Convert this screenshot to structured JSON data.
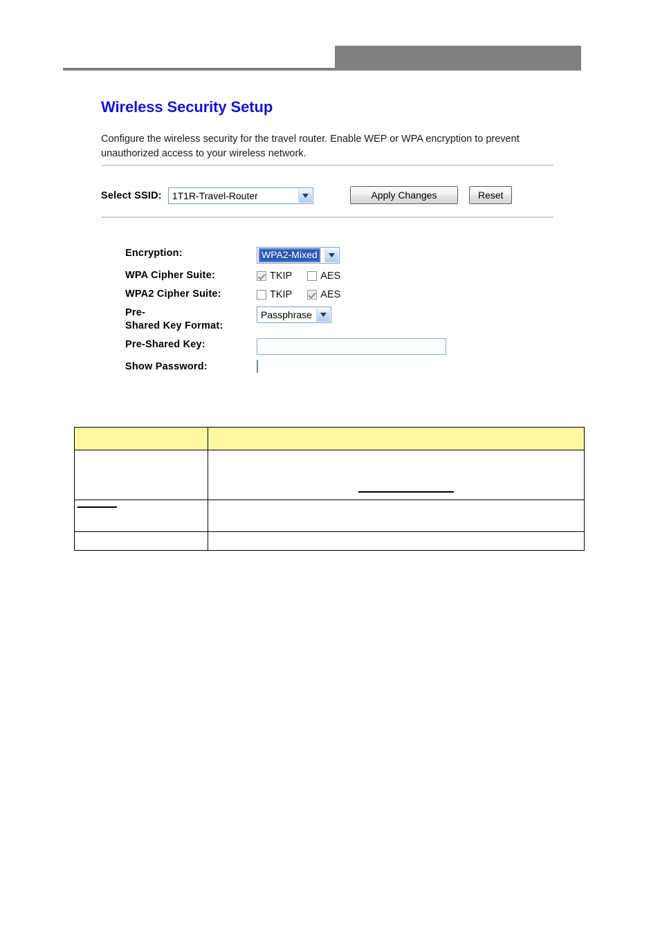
{
  "page": {
    "header_band_color": "#808080",
    "panel_title": "Wireless Security Setup",
    "panel_description": "Configure the wireless security for the travel router. Enable WEP or WPA encryption to prevent unauthorized access to your wireless network."
  },
  "ssid_row": {
    "label": "Select SSID:",
    "selected": "1T1R-Travel-Router",
    "options": [
      "1T1R-Travel-Router"
    ],
    "apply_label": "Apply Changes",
    "reset_label": "Reset"
  },
  "form": {
    "encryption": {
      "label": "Encryption:",
      "selected": "WPA2-Mixed",
      "options": [
        "WPA2-Mixed"
      ],
      "highlight_color": "#2a58b5"
    },
    "wpa_cipher": {
      "label": "WPA Cipher Suite:",
      "tkip_label": "TKIP",
      "tkip_checked": true,
      "tkip_disabled": true,
      "aes_label": "AES",
      "aes_checked": false,
      "aes_disabled": true
    },
    "wpa2_cipher": {
      "label": "WPA2 Cipher Suite:",
      "tkip_label": "TKIP",
      "tkip_checked": false,
      "tkip_disabled": true,
      "aes_label": "AES",
      "aes_checked": true,
      "aes_disabled": true
    },
    "psk_format": {
      "label_line1": "Pre-",
      "label_line2": "Shared Key Format:",
      "selected": "Passphrase",
      "options": [
        "Passphrase"
      ]
    },
    "psk": {
      "label": "Pre-Shared Key:",
      "value": "",
      "placeholder": ""
    },
    "show_password": {
      "label": "Show Password:",
      "checked": false
    }
  },
  "description_table": {
    "header_color": "#fdf8a0",
    "rows": [
      {
        "col_a": "",
        "col_b": ""
      },
      {
        "col_a": "",
        "col_b": ""
      },
      {
        "col_a": "",
        "col_b": ""
      },
      {
        "col_a": "",
        "col_b": ""
      }
    ]
  }
}
